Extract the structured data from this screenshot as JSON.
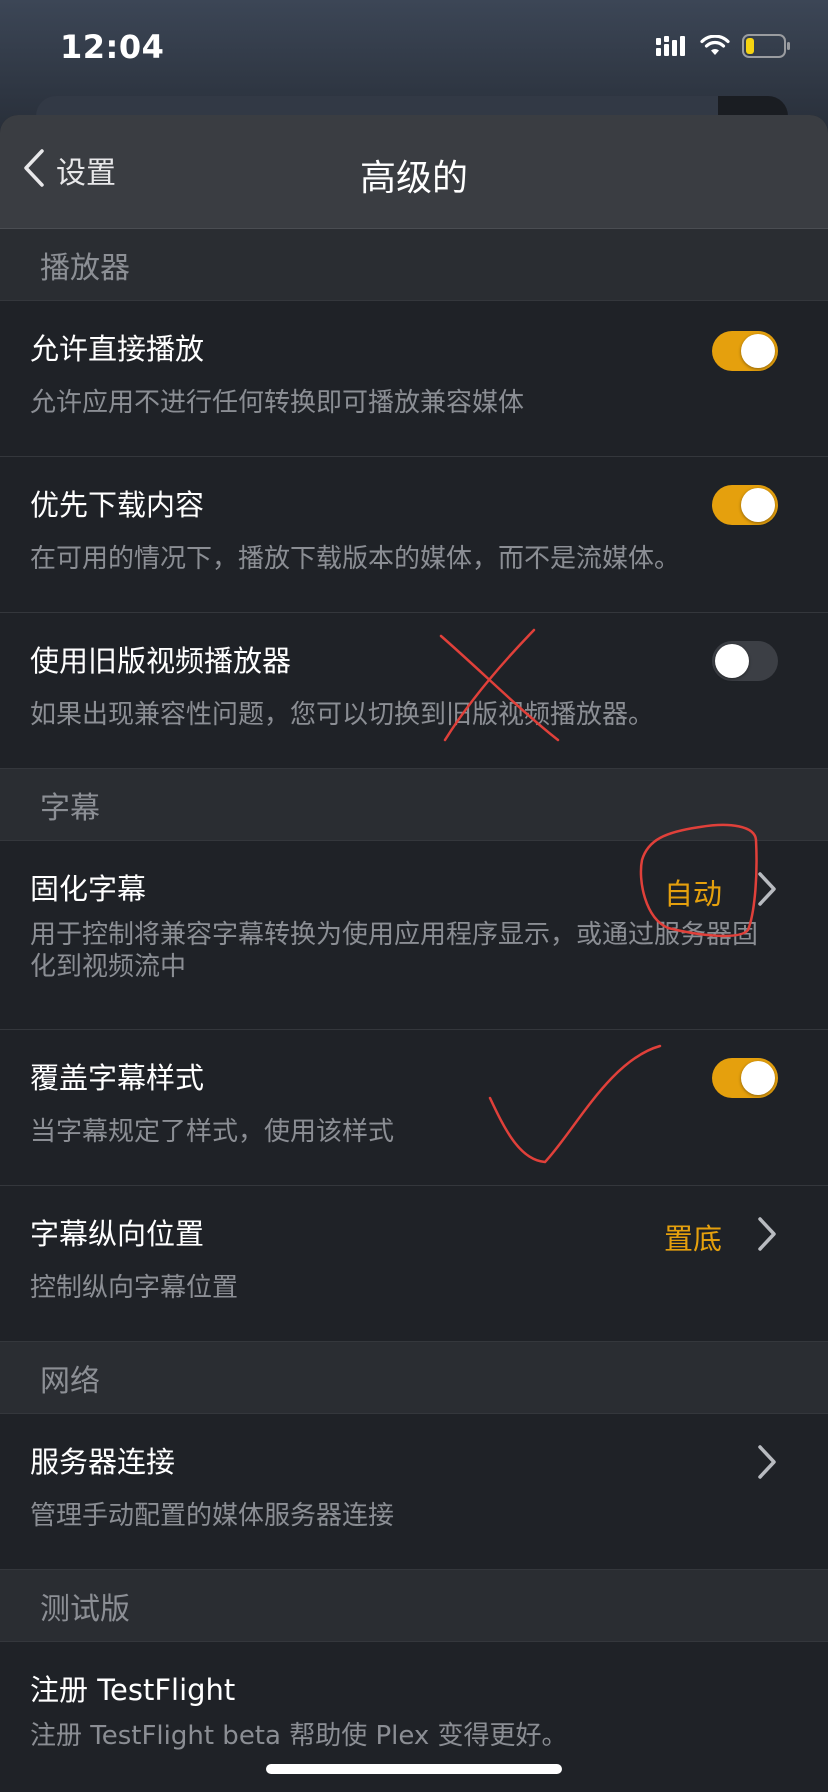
{
  "status_bar": {
    "time": "12:04",
    "signal_icon": "cellular-signal-icon",
    "wifi_icon": "wifi-icon",
    "battery_icon": "battery-low-icon"
  },
  "nav": {
    "back_label": "设置",
    "title": "高级的"
  },
  "sections": {
    "player": {
      "header": "播放器",
      "direct_play": {
        "title": "允许直接播放",
        "desc": "允许应用不进行任何转换即可播放兼容媒体",
        "enabled": true
      },
      "prefer_download": {
        "title": "优先下载内容",
        "desc": "在可用的情况下，播放下载版本的媒体，而不是流媒体。",
        "enabled": true
      },
      "legacy_player": {
        "title": "使用旧版视频播放器",
        "desc": "如果出现兼容性问题，您可以切换到旧版视频播放器。",
        "enabled": false
      }
    },
    "subtitles": {
      "header": "字幕",
      "burn_subtitles": {
        "title": "固化字幕",
        "value": "自动",
        "desc": "用于控制将兼容字幕转换为使用应用程序显示，或通过服务器固化到视频流中"
      },
      "override_style": {
        "title": "覆盖字幕样式",
        "desc": "当字幕规定了样式，使用该样式",
        "enabled": true
      },
      "vertical_position": {
        "title": "字幕纵向位置",
        "value": "置底",
        "desc": "控制纵向字幕位置"
      }
    },
    "network": {
      "header": "网络",
      "server_connections": {
        "title": "服务器连接",
        "desc": "管理手动配置的媒体服务器连接"
      }
    },
    "beta": {
      "header": "测试版",
      "testflight": {
        "title": "注册 TestFlight",
        "desc": "注册 TestFlight beta 帮助使 Plex 变得更好。"
      }
    }
  },
  "colors": {
    "accent": "#e5a00d",
    "background": "#1f2227",
    "section_header_bg": "#2a2d32",
    "nav_bar_bg": "#3a3d42",
    "annotation_red": "#e0403a"
  },
  "annotations": [
    "red-x-mark",
    "red-circle-mark",
    "red-check-mark"
  ]
}
